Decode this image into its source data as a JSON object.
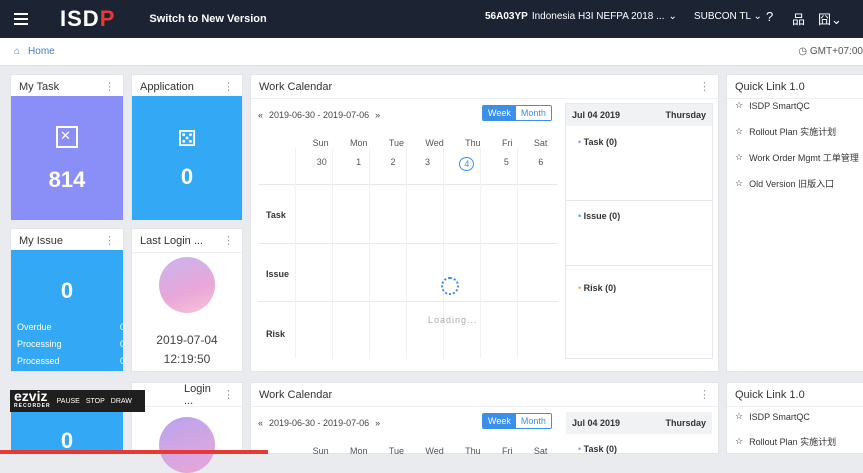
{
  "topbar": {
    "logo_main": "ISD",
    "logo_accent": "P",
    "switch_label": "Switch to New Version",
    "project_code": "56A03YP",
    "project_name": "Indonesia H3I NEFPA 2018 ...",
    "subcon": "SUBCON TL",
    "help_icon": "?",
    "org_icon": "品",
    "grid_icon": "囧"
  },
  "breadcrumb": {
    "home_label": "Home",
    "timezone": "GMT+07:00"
  },
  "my_task": {
    "title": "My Task",
    "count": "814"
  },
  "application": {
    "title": "Application",
    "count": "0"
  },
  "my_issue": {
    "title": "My Issue",
    "count": "0",
    "rows": [
      {
        "label": "Overdue",
        "value": "0"
      },
      {
        "label": "Processing",
        "value": "0"
      },
      {
        "label": "Processed",
        "value": "0"
      }
    ]
  },
  "last_login": {
    "title": "Last Login ...",
    "date": "2019-07-04",
    "time": "12:19:50"
  },
  "calendar": {
    "title": "Work Calendar",
    "range": "2019-06-30 - 2019-07-06",
    "week_label": "Week",
    "month_label": "Month",
    "days": [
      "Sun",
      "Mon",
      "Tue",
      "Wed",
      "Thu",
      "Fri",
      "Sat"
    ],
    "dates": [
      "30",
      "1",
      "2",
      "3",
      "4",
      "5",
      "6"
    ],
    "rows": [
      "Task",
      "Issue",
      "Risk"
    ],
    "loading": "Loading...",
    "side_date": "Jul 04 2019",
    "side_day": "Thursday",
    "side_task": "Task (0)",
    "side_issue": "Issue (0)",
    "side_risk": "Risk (0)"
  },
  "quick_link": {
    "title": "Quick Link 1.0",
    "items": [
      "ISDP SmartQC",
      "Rollout Plan 实施计划",
      "Work Order Mgmt 工单管理",
      "Old Version 旧版入口"
    ]
  },
  "row2": {
    "login_title": "Login ...",
    "calendar_title": "Work Calendar",
    "range": "2019-06-30 - 2019-07-06",
    "week_label": "Week",
    "month_label": "Month",
    "side_date": "Jul 04 2019",
    "side_day": "Thursday",
    "side_task": "Task (0)",
    "quick_title": "Quick Link 1.0",
    "quick_items": [
      "ISDP SmartQC",
      "Rollout Plan 实施计划"
    ],
    "issue_count": "0",
    "days": [
      "Sun",
      "Mon",
      "Tue",
      "Wed",
      "Thu",
      "Fri",
      "Sat"
    ]
  },
  "recorder": {
    "brand": "ezviz",
    "sub": "RECORDER",
    "pause": "PAUSE",
    "stop": "STOP",
    "draw": "DRAW"
  },
  "colors": {
    "tile_purple": "#8a8ef7",
    "tile_blue": "#33a9f5",
    "accent": "#3b8fe8"
  }
}
